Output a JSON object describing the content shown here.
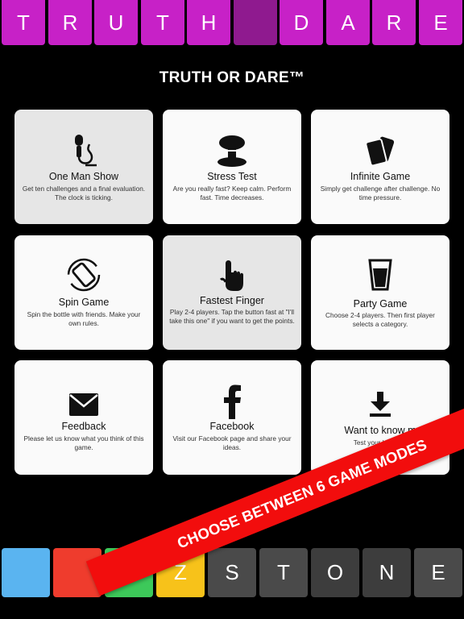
{
  "top_tiles": [
    {
      "letter": "T",
      "color": "#c721c7"
    },
    {
      "letter": "R",
      "color": "#c721c7"
    },
    {
      "letter": "U",
      "color": "#c721c7"
    },
    {
      "letter": "T",
      "color": "#c721c7"
    },
    {
      "letter": "H",
      "color": "#c721c7"
    },
    {
      "letter": "",
      "color": "#8f1a8f"
    },
    {
      "letter": "D",
      "color": "#c721c7"
    },
    {
      "letter": "A",
      "color": "#c721c7"
    },
    {
      "letter": "R",
      "color": "#c721c7"
    },
    {
      "letter": "E",
      "color": "#c721c7"
    }
  ],
  "header": {
    "title": "TRUTH OR DARE™"
  },
  "modes": [
    {
      "title": "One Man Show",
      "desc": "Get ten challenges and a final evaluation. The clock is ticking.",
      "icon": "microphone-icon"
    },
    {
      "title": "Stress Test",
      "desc": "Are you really fast? Keep calm. Perform fast. Time decreases.",
      "icon": "explosion-icon"
    },
    {
      "title": "Infinite Game",
      "desc": "Simply get challenge after challenge. No time pressure.",
      "icon": "cards-icon"
    },
    {
      "title": "Spin Game",
      "desc": "Spin the bottle with friends. Make your own rules.",
      "icon": "rotate-icon"
    },
    {
      "title": "Fastest Finger",
      "desc": "Play 2-4 players. Tap the button fast at \"I'll take this one\" if you want to get the points.",
      "icon": "pointer-hand-icon"
    },
    {
      "title": "Party Game",
      "desc": "Choose 2-4 players. Then first player selects a category.",
      "icon": "drink-glass-icon"
    },
    {
      "title": "Feedback",
      "desc": "Please let us know what you think of this game.",
      "icon": "envelope-icon"
    },
    {
      "title": "Facebook",
      "desc": "Visit our Facebook page and share your ideas.",
      "icon": "facebook-icon"
    },
    {
      "title": "Want to know m",
      "desc": "Test your knowled",
      "icon": "download-icon"
    }
  ],
  "banner": {
    "text": "CHOOSE BETWEEN 6 GAME MODES"
  },
  "bottom_tiles": [
    {
      "letter": "",
      "color": "#5ab4f0"
    },
    {
      "letter": "",
      "color": "#ef3c2d"
    },
    {
      "letter": "I",
      "color": "#3dc95a"
    },
    {
      "letter": "Z",
      "color": "#f7c21a"
    },
    {
      "letter": "S",
      "color": "#4a4a4a"
    },
    {
      "letter": "T",
      "color": "#4a4a4a"
    },
    {
      "letter": "O",
      "color": "#3d3d3d"
    },
    {
      "letter": "N",
      "color": "#3d3d3d"
    },
    {
      "letter": "E",
      "color": "#4a4a4a"
    }
  ]
}
